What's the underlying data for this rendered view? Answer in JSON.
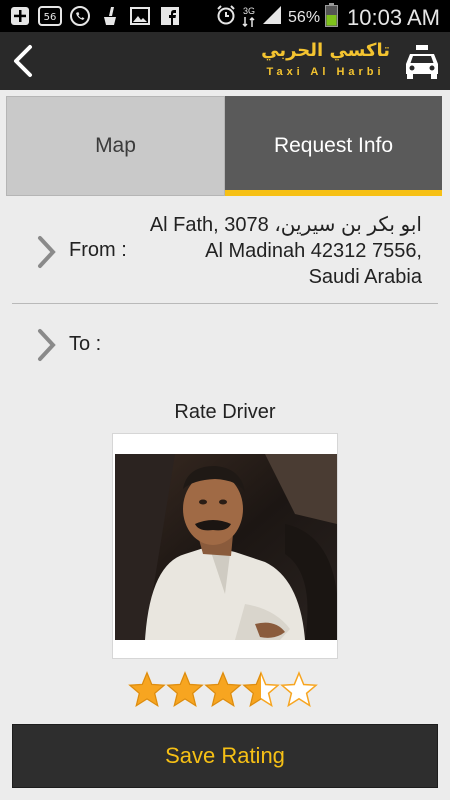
{
  "status_bar": {
    "network": "3G",
    "battery": "56%",
    "time": "10:03 AM",
    "badge": "56"
  },
  "header": {
    "brand_ar": "تاكسي الحربي",
    "brand_en": "Taxi Al Harbi"
  },
  "tabs": [
    {
      "label": "Map",
      "active": false
    },
    {
      "label": "Request Info",
      "active": true
    }
  ],
  "request": {
    "from_label": "From :",
    "from_address_lines": [
      "Al Fath, ابو بكر بن سيرين، 3078",
      "Al Madinah 42312 7556,",
      "Saudi Arabia"
    ],
    "to_label": "To :"
  },
  "rating": {
    "title": "Rate Driver",
    "stars": 3.5,
    "max_stars": 5
  },
  "save_button": "Save Rating",
  "colors": {
    "accent": "#f6c015",
    "header": "#292929",
    "tab_active": "#5a5a5a",
    "tab_inactive": "#c9c9c9",
    "star": "#f7a520"
  }
}
